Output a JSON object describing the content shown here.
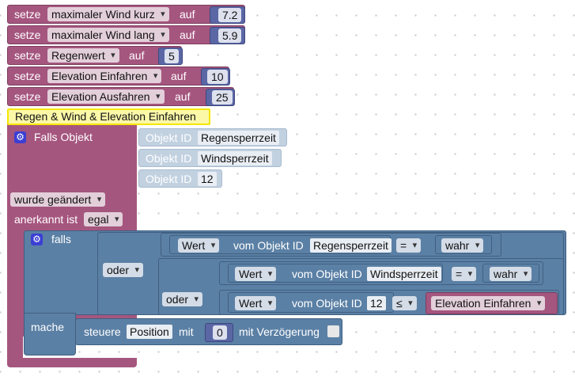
{
  "set_blocks": [
    {
      "set_label": "setze",
      "variable": "maximaler Wind kurz",
      "to_label": "auf",
      "value": "7.2"
    },
    {
      "set_label": "setze",
      "variable": "maximaler Wind lang",
      "to_label": "auf",
      "value": "5.9"
    },
    {
      "set_label": "setze",
      "variable": "Regenwert",
      "to_label": "auf",
      "value": "5"
    },
    {
      "set_label": "setze",
      "variable": "Elevation Einfahren",
      "to_label": "auf",
      "value": "10"
    },
    {
      "set_label": "setze",
      "variable": "Elevation Ausfahren",
      "to_label": "auf",
      "value": "25"
    }
  ],
  "trigger": {
    "comment": "Regen & Wind & Elevation Einfahren",
    "falls_objekt": "Falls Objekt",
    "objects": [
      {
        "label": "Objekt ID",
        "value": "Regensperrzeit"
      },
      {
        "label": "Objekt ID",
        "value": "Windsperrzeit"
      },
      {
        "label": "Objekt ID",
        "value": "12"
      }
    ],
    "changed": "wurde geändert",
    "ack_label": "anerkannt ist",
    "ack_value": "egal"
  },
  "if_block": {
    "falls": "falls",
    "mache": "mache",
    "or1": "oder",
    "or2": "oder",
    "cond1": {
      "wert": "Wert",
      "from": "vom Objekt ID",
      "object": "Regensperrzeit",
      "op": "=",
      "value": "wahr"
    },
    "cond2": {
      "wert": "Wert",
      "from": "vom Objekt ID",
      "object": "Windsperrzeit",
      "op": "=",
      "value": "wahr"
    },
    "cond3": {
      "wert": "Wert",
      "from": "vom Objekt ID",
      "object": "12",
      "op": "≤",
      "variable": "Elevation Einfahren"
    },
    "control": {
      "label": "steuere",
      "object": "Position",
      "with": "mit",
      "value": "0",
      "delay": "mit Verzögerung"
    }
  }
}
